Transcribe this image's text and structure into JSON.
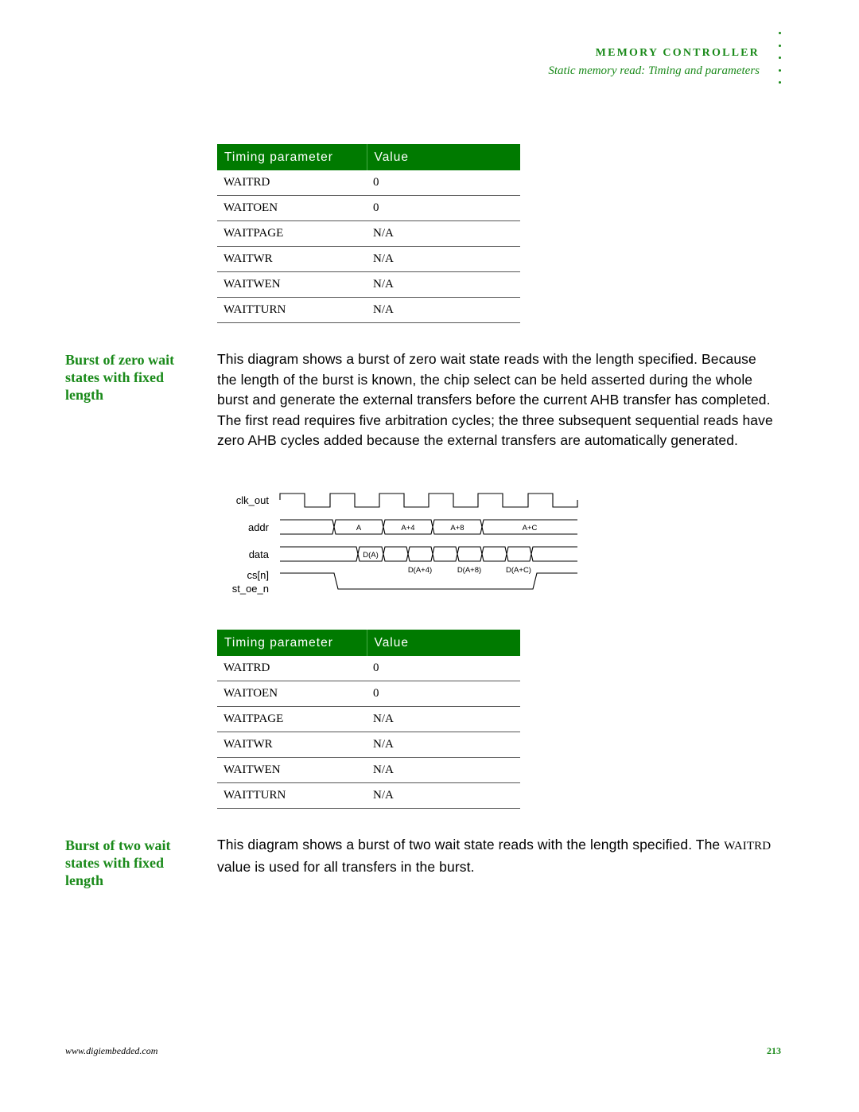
{
  "header": {
    "title": "MEMORY CONTROLLER",
    "subtitle": "Static memory read: Timing and parameters"
  },
  "table1": {
    "headers": [
      "Timing parameter",
      "Value"
    ],
    "rows": [
      [
        "WAITRD",
        "0"
      ],
      [
        "WAITOEN",
        "0"
      ],
      [
        "WAITPAGE",
        "N/A"
      ],
      [
        "WAITWR",
        "N/A"
      ],
      [
        "WAITWEN",
        "N/A"
      ],
      [
        "WAITTURN",
        "N/A"
      ]
    ]
  },
  "section1": {
    "heading": "Burst of zero wait states with fixed length",
    "body": "This diagram shows a burst of zero wait state reads with the length specified. Because the length of the burst is known, the chip select can be held asserted during the whole burst and generate the external transfers before the current AHB transfer has completed. The first read requires five arbitration cycles; the three subsequent sequential reads have zero AHB cycles added because the external transfers are automatically generated."
  },
  "diagram": {
    "signals": [
      "clk_out",
      "addr",
      "data",
      "cs[n]",
      "st_oe_n"
    ],
    "addr_labels": [
      "A",
      "A+4",
      "A+8",
      "A+C"
    ],
    "data_labels": [
      "D(A)",
      "D(A+4)",
      "D(A+8)",
      "D(A+C)"
    ]
  },
  "table2": {
    "headers": [
      "Timing parameter",
      "Value"
    ],
    "rows": [
      [
        "WAITRD",
        "0"
      ],
      [
        "WAITOEN",
        "0"
      ],
      [
        "WAITPAGE",
        "N/A"
      ],
      [
        "WAITWR",
        "N/A"
      ],
      [
        "WAITWEN",
        "N/A"
      ],
      [
        "WAITTURN",
        "N/A"
      ]
    ]
  },
  "section2": {
    "heading": "Burst of two wait states with fixed length",
    "body_pre": "This diagram shows a burst of two wait state reads with the length specified. The ",
    "body_code": "WAITRD",
    "body_post": " value is used for all transfers in the burst."
  },
  "footer": {
    "url": "www.digiembedded.com",
    "page": "213"
  },
  "colors": {
    "accent": "#1a8a1a",
    "table_header": "#007a00"
  }
}
